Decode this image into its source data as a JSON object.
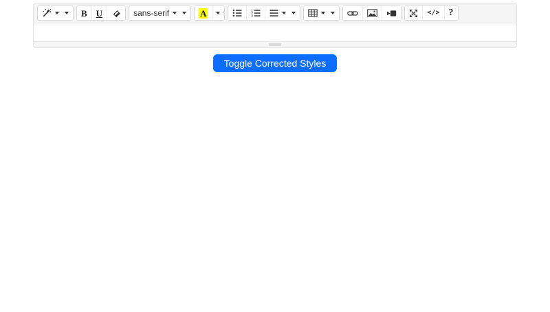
{
  "colors": {
    "accent": "#0d6efd",
    "toolbar_bg": "#f5f5f5",
    "border": "#e2e2e2",
    "icon": "#333333",
    "color_highlight": "#ffff00"
  },
  "toolbar": {
    "bold_label": "B",
    "underline_label": "U",
    "fontname_value": "sans-serif",
    "color_label": "A",
    "codeview_label": "</>",
    "help_label": "?",
    "icons": [
      "magic-wand-icon",
      "caret-down-icon",
      "eraser-icon",
      "unordered-list-icon",
      "ordered-list-icon",
      "align-left-icon",
      "table-icon",
      "link-icon",
      "picture-icon",
      "video-icon",
      "fullscreen-icon",
      "resize-handle"
    ]
  },
  "editor": {
    "content": ""
  },
  "toggle_button": {
    "label": "Toggle Corrected Styles"
  }
}
